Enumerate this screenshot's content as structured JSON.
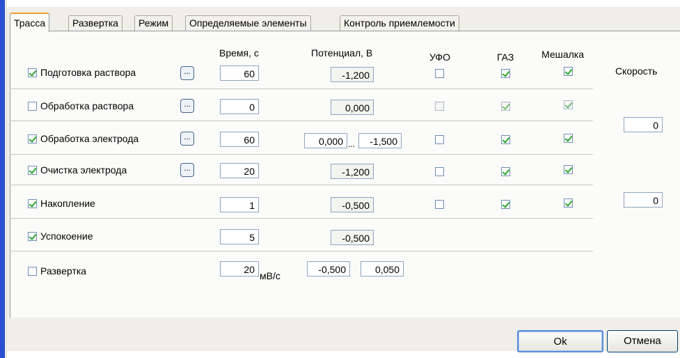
{
  "tabs": [
    {
      "label": "Трасса",
      "active": true
    },
    {
      "label": "Развертка",
      "active": false
    },
    {
      "label": "Режим",
      "active": false
    },
    {
      "label": "Определяемые элементы",
      "active": false
    },
    {
      "label": "Контроль приемлемости",
      "active": false
    }
  ],
  "headers": {
    "time": "Время, с",
    "potential": "Потенциал, В",
    "ufo": "УФО",
    "gas": "ГАЗ",
    "stirrer": "Мешалка",
    "speed": "Скорость"
  },
  "rows": [
    {
      "label": "Подготовка раствора",
      "enabled": true,
      "time": "60",
      "potential": "-1,200",
      "ufo": false,
      "gas": true,
      "stirrer": true
    },
    {
      "label": "Обработка раствора",
      "enabled": false,
      "time": "0",
      "potential": "0,000",
      "ufo": false,
      "gas": true,
      "stirrer": true
    },
    {
      "label": "Обработка электрода",
      "enabled": true,
      "time": "60",
      "potential_from": "0,000",
      "range_sep": "...",
      "potential_to": "-1,500",
      "ufo": false,
      "gas": true,
      "stirrer": true
    },
    {
      "label": "Очистка электрода",
      "enabled": true,
      "time": "20",
      "potential": "-1,200",
      "ufo": false,
      "gas": true,
      "stirrer": true
    },
    {
      "label": "Накопление",
      "enabled": true,
      "time": "1",
      "potential": "-0,500",
      "ufo": false,
      "gas": true,
      "stirrer": true
    },
    {
      "label": "Успокоение",
      "enabled": true,
      "time": "5",
      "potential": "-0,500"
    },
    {
      "label": "Развертка",
      "enabled": false,
      "time": "20",
      "unit": "мВ/с",
      "potential_from": "-0,500",
      "potential_to": "0,050"
    }
  ],
  "dots_label": "...",
  "speed_values": [
    "0",
    "0"
  ],
  "buttons": {
    "ok": "Ok",
    "cancel": "Отмена"
  },
  "colors": {
    "check": "#2aa32a",
    "active_tab_accent": "#f0a030",
    "left_stripe": "#2a4fd0"
  }
}
